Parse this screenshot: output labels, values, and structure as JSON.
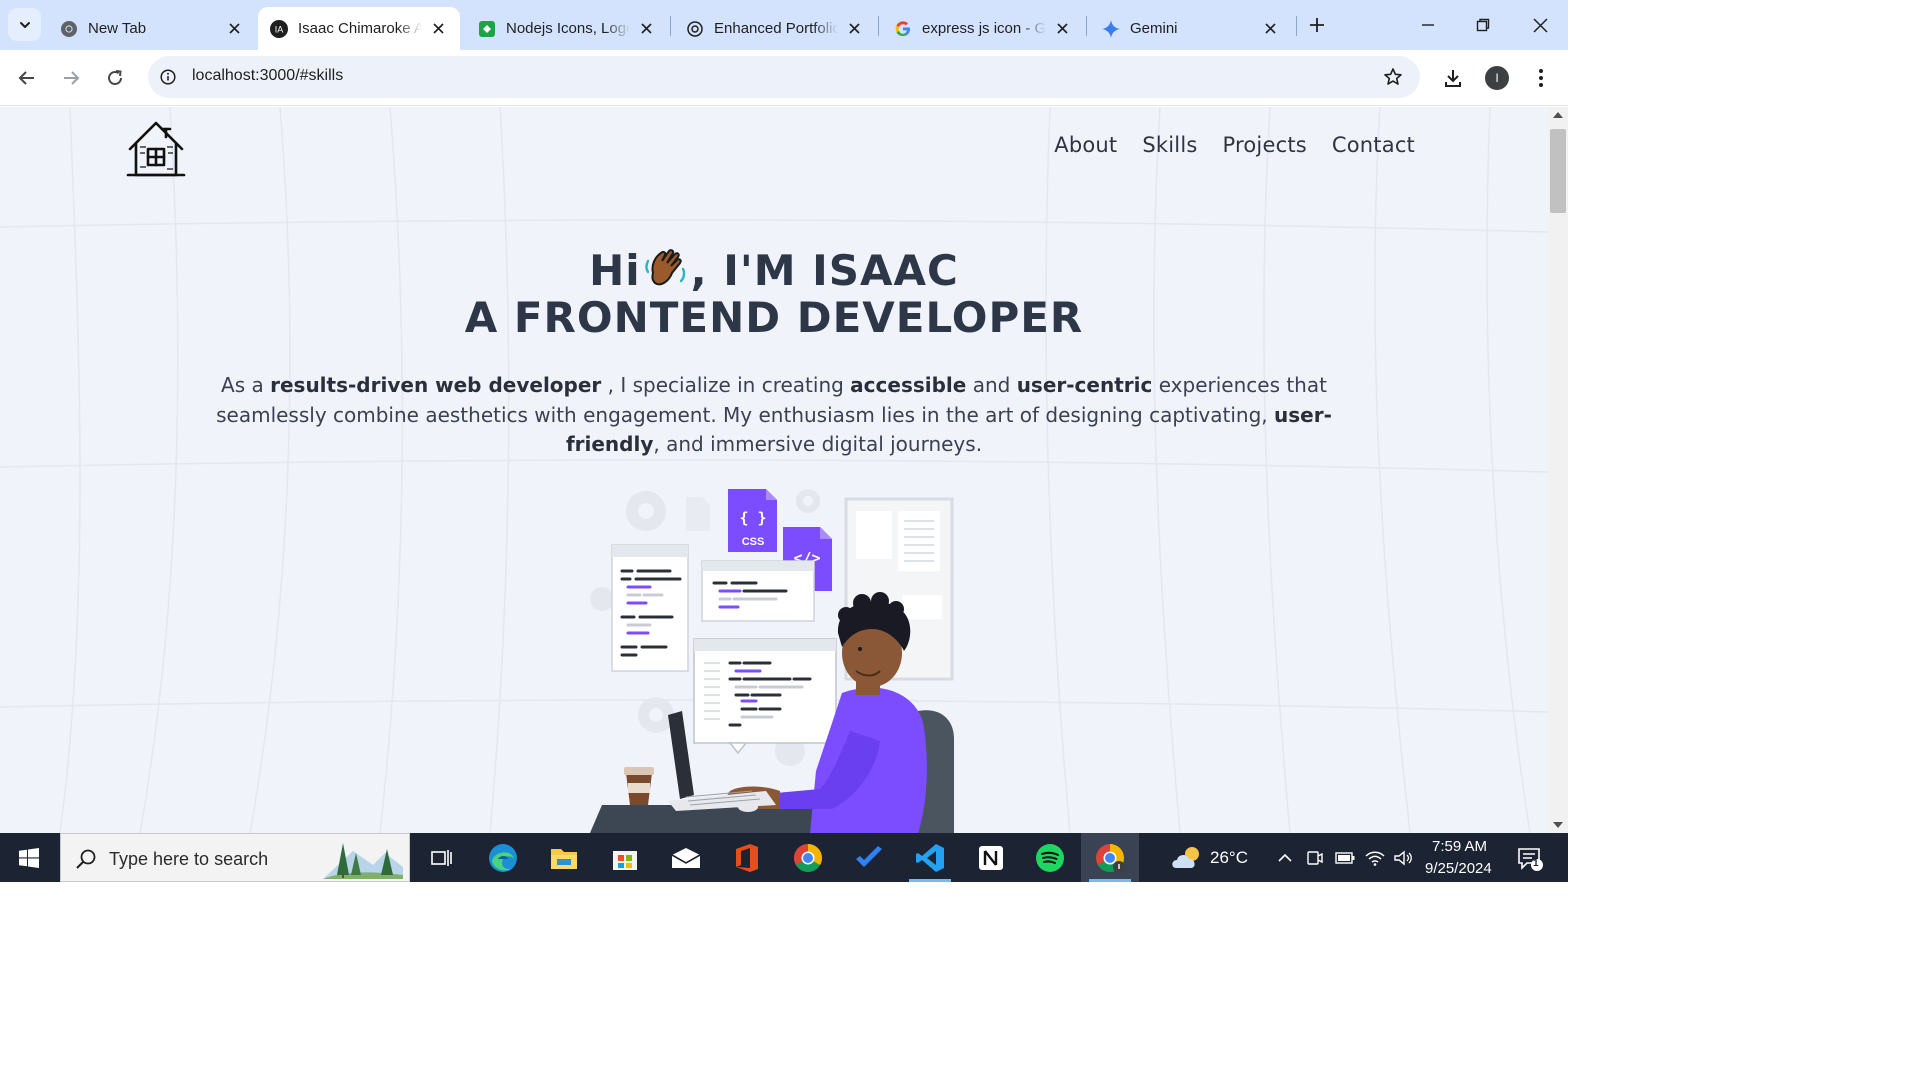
{
  "browser": {
    "tabs": [
      {
        "title": "New Tab",
        "icon": "chrome-icon",
        "active": false
      },
      {
        "title": "Isaac Chimaroke A",
        "icon": "ia-avatar-icon",
        "active": true
      },
      {
        "title": "Nodejs Icons, Logo",
        "icon": "node-green-icon",
        "active": false
      },
      {
        "title": "Enhanced Portfolio",
        "icon": "openai-icon",
        "active": false
      },
      {
        "title": "express js icon - G",
        "icon": "google-icon",
        "active": false
      },
      {
        "title": "Gemini",
        "icon": "gemini-sparkle-icon",
        "active": false
      }
    ],
    "favicon_text": {
      "ia": "IA"
    },
    "address": "localhost:3000/#skills",
    "profile_initial": "I",
    "colors": {
      "tabstrip": "#d3e3fd",
      "omnibox": "#edf2fa"
    }
  },
  "site": {
    "nav": [
      "About",
      "Skills",
      "Projects",
      "Contact"
    ],
    "hero": {
      "hi": "Hi",
      "after_wave": ", I'M ISAAC",
      "line2": "A FRONTEND DEVELOPER"
    },
    "intro": {
      "p1": "As a ",
      "b1": "results-driven web developer",
      "p2": " , I specialize in creating ",
      "b2": "accessible",
      "p3": " and ",
      "b3": "user-centric",
      "p4": " experiences that seamlessly combine aesthetics with engagement. My enthusiasm lies in the art of designing captivating, ",
      "b4": "user-friendly",
      "p5": ", and immersive digital journeys."
    },
    "illustration": {
      "css_label": "CSS",
      "code_label": "</>",
      "braces": "{ }"
    },
    "colors": {
      "accent": "#7b4dff",
      "heading": "#2d3748",
      "background": "#f0f3f9"
    }
  },
  "taskbar": {
    "search_placeholder": "Type here to search",
    "apps": [
      "task-view-icon",
      "edge-icon",
      "file-explorer-icon",
      "store-icon",
      "mail-icon",
      "office-icon",
      "chrome-icon",
      "todo-icon",
      "vscode-icon",
      "notion-icon",
      "spotify-icon",
      "chrome-profile-icon"
    ],
    "weather": "26°C",
    "time": "7:59 AM",
    "date": "9/25/2024",
    "notification_count": "1"
  }
}
